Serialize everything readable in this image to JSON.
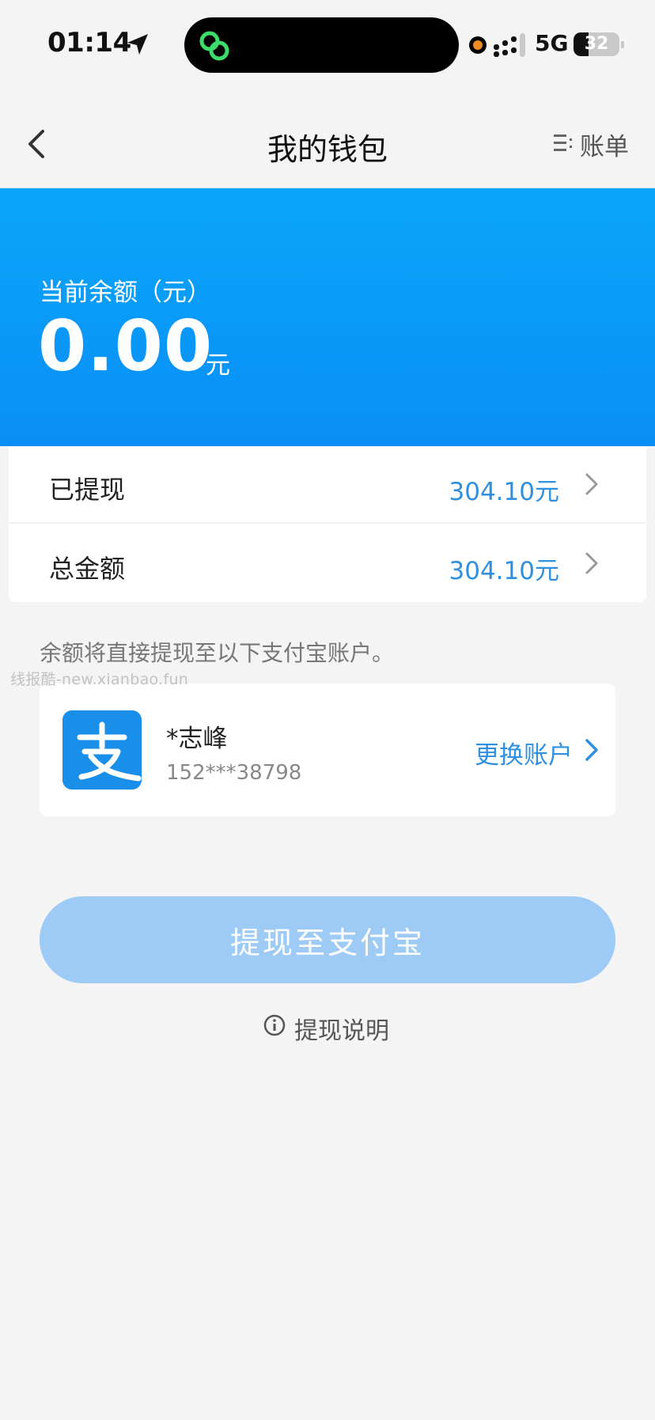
{
  "status_bar": {
    "time": "01:14",
    "network": "5G",
    "battery": "32",
    "battery_level": 0.32
  },
  "header": {
    "title": "我的钱包",
    "bill_label": "账单"
  },
  "balance": {
    "label": "当前余额（元）",
    "value": "0.00",
    "unit": "元"
  },
  "rows": [
    {
      "label": "已提现",
      "value": "304.10元"
    },
    {
      "label": "总金额",
      "value": "304.10元"
    }
  ],
  "note": "余额将直接提现至以下支付宝账户。",
  "watermark": "线报酷-new.xianbao.fun",
  "account": {
    "name": "*志峰",
    "phone": "152***38798",
    "change_label": "更换账户"
  },
  "withdraw_button": "提现至支付宝",
  "withdraw_info": "提现说明",
  "colors": {
    "banner": "#0a9bf8",
    "accent": "#2f8fe0",
    "button": "#9dcbf6",
    "alipay": "#1a8fea"
  }
}
